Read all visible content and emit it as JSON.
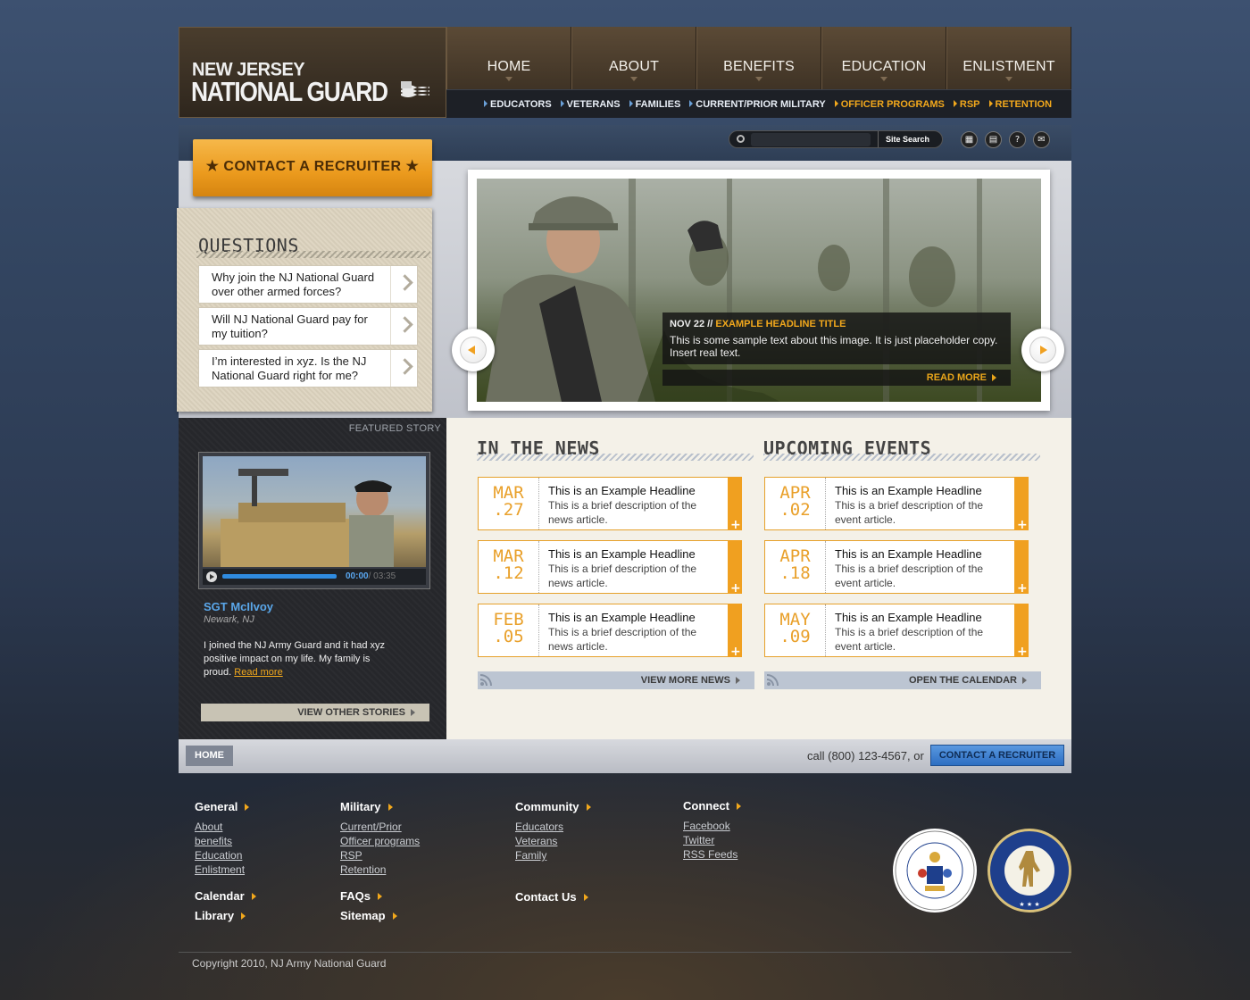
{
  "logo": {
    "line1": "NEW JERSEY",
    "line2": "NATIONAL GUARD"
  },
  "main_nav": [
    "HOME",
    "ABOUT",
    "BENEFITS",
    "EDUCATION",
    "ENLISTMENT"
  ],
  "sub_nav": {
    "blue": [
      "EDUCATORS",
      "VETERANS",
      "FAMILIES",
      "CURRENT/PRIOR MILITARY"
    ],
    "orange": [
      "OFFICER PROGRAMS",
      "RSP",
      "RETENTION"
    ]
  },
  "search": {
    "placeholder": "",
    "button": "Site Search"
  },
  "toolbar_icons": [
    "calendar-icon",
    "document-icon",
    "help-icon",
    "mail-icon"
  ],
  "contact_recruiter": "★ CONTACT A RECRUITER ★",
  "questions": {
    "title": "QUESTIONS",
    "items": [
      "Why join the NJ National Guard over other armed forces?",
      "Will NJ National Guard pay for my tuition?",
      "I’m interested in xyz. Is the NJ National Guard right for me?"
    ]
  },
  "slider": {
    "date": "NOV 22 //",
    "headline": "EXAMPLE HEADLINE TITLE",
    "text": "This is some sample text about this image. It is just placeholder copy. Insert real text.",
    "read_more": "READ MORE"
  },
  "featured": {
    "label": "FEATURED STORY",
    "video_time": "00:00",
    "video_total": "/ 03:35",
    "name": "SGT McIlvoy",
    "location": "Newark, NJ",
    "story": "I joined the NJ Army Guard and it had xyz positive impact on my life. My family is proud.",
    "read_more": "Read more",
    "view_other": "VIEW OTHER STORIES"
  },
  "news": {
    "title": "IN THE NEWS",
    "items": [
      {
        "month": "MAR",
        "day": ".27",
        "headline": "This is an Example Headline",
        "desc": "This is a brief description of the news article."
      },
      {
        "month": "MAR",
        "day": ".12",
        "headline": "This is an Example Headline",
        "desc": "This is a brief description of the news article."
      },
      {
        "month": "FEB",
        "day": ".05",
        "headline": "This is an Example Headline",
        "desc": "This is a brief description of the news article."
      }
    ],
    "more": "VIEW MORE NEWS"
  },
  "events": {
    "title": "UPCOMING EVENTS",
    "items": [
      {
        "month": "APR",
        "day": ".02",
        "headline": "This is an Example Headline",
        "desc": "This is a brief description of the event article."
      },
      {
        "month": "APR",
        "day": ".18",
        "headline": "This is an Example Headline",
        "desc": "This is a brief description of the event article."
      },
      {
        "month": "MAY",
        "day": ".09",
        "headline": "This is an Example Headline",
        "desc": "This is a brief description of the event article."
      }
    ],
    "more": "OPEN THE CALENDAR"
  },
  "breadcrumb": {
    "home": "HOME",
    "call": "call (800) 123-4567, or",
    "contact": "CONTACT A RECRUITER"
  },
  "footer": {
    "general": {
      "title": "General",
      "links": [
        "About",
        "benefits",
        "Education",
        "Enlistment"
      ]
    },
    "military": {
      "title": "Military",
      "links": [
        "Current/Prior",
        "Officer programs",
        "RSP",
        "Retention"
      ]
    },
    "community": {
      "title": "Community",
      "links": [
        "Educators",
        "Veterans",
        "Family"
      ]
    },
    "connect": {
      "title": "Connect",
      "links": [
        "Facebook",
        "Twitter",
        "RSS Feeds"
      ]
    },
    "calendar": "Calendar",
    "library": "Library",
    "faqs": "FAQs",
    "sitemap": "Sitemap",
    "contact": "Contact Us",
    "copyright": "Copyright 2010, NJ Army National Guard",
    "seals": {
      "nj_text": "THE GREAT SEAL OF THE STATE OF NEW JERSEY",
      "army_text": "ARMY NATIONAL GUARD"
    }
  },
  "colors": {
    "accent": "#f0a020",
    "link_blue": "#5aa7ea",
    "dark": "#26272b"
  }
}
